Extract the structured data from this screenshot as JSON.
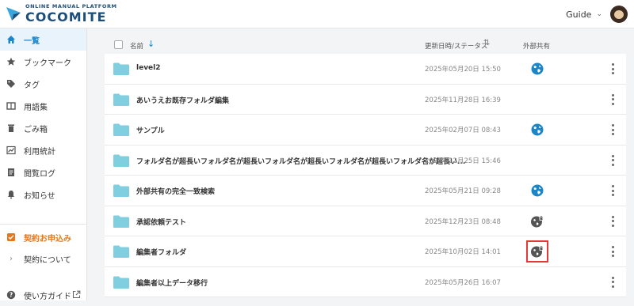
{
  "app": {
    "logo_sub": "ONLINE MANUAL PLATFORM",
    "logo_main": "COCOMITE",
    "brand_color": "#1d4e7a",
    "accent_color": "#1a86c8"
  },
  "header": {
    "user_name": "Guide",
    "user_menu_icon": "chevron-down-icon"
  },
  "sidebar": {
    "items": [
      {
        "label": "一覧",
        "icon": "home-icon",
        "active": true
      },
      {
        "label": "ブックマーク",
        "icon": "star-icon"
      },
      {
        "label": "タグ",
        "icon": "tag-icon"
      },
      {
        "label": "用語集",
        "icon": "book-icon"
      },
      {
        "label": "ごみ箱",
        "icon": "trash-icon"
      },
      {
        "label": "利用統計",
        "icon": "chart-icon"
      },
      {
        "label": "閲覧ログ",
        "icon": "document-icon"
      },
      {
        "label": "お知らせ",
        "icon": "bell-icon"
      }
    ],
    "contract_apply": "契約お申込み",
    "contract_about": "契約について",
    "guide": "使い方ガイド"
  },
  "table": {
    "col_name": "名前",
    "col_updated": "更新日時/ステータス",
    "col_share": "外部共有",
    "rows": [
      {
        "name": "level2",
        "date": "2025年05月20日 15:50",
        "share": "public"
      },
      {
        "name": "あいうえお既存フォルダ編集",
        "date": "2025年11月28日 16:39",
        "share": "none"
      },
      {
        "name": "サンプル",
        "date": "2025年02月07日 08:43",
        "share": "public"
      },
      {
        "name": "フォルダ名が超長いフォルダ名が超長いフォルダ名が超長いフォルダ名が超長いフォルダ名が超長い...",
        "date": "2025年12月25日 15:46",
        "share": "none"
      },
      {
        "name": "外部共有の完全一致検索",
        "date": "2025年05月21日 09:28",
        "share": "public"
      },
      {
        "name": "承認依頼テスト",
        "date": "2025年12月23日 08:48",
        "share": "locked"
      },
      {
        "name": "編集者フォルダ",
        "date": "2025年10月02日 14:01",
        "share": "locked",
        "highlight": true
      },
      {
        "name": "編集者以上データ移行",
        "date": "2025年05月26日 16:07",
        "share": "none"
      }
    ]
  }
}
